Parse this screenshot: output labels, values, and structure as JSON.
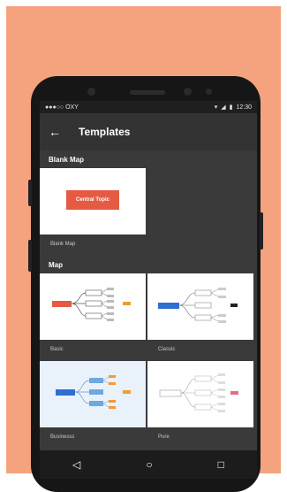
{
  "status": {
    "carrier": "●●●○○ OXY",
    "time": "12:30"
  },
  "header": {
    "title": "Templates"
  },
  "sections": {
    "blank": {
      "label": "Blank Map",
      "card_label": "Blank Map",
      "central_topic": "Central Topic"
    },
    "map": {
      "label": "Map",
      "cards": [
        {
          "label": "Basic"
        },
        {
          "label": "Classic"
        },
        {
          "label": "Businesss"
        },
        {
          "label": "Pure"
        }
      ]
    }
  },
  "colors": {
    "accent_red": "#e45a43",
    "accent_blue": "#2f6fcf",
    "accent_orange": "#f39a34",
    "accent_pink": "#e66b83",
    "background_orange": "#f5a27e"
  },
  "icons": {
    "back": "arrow-left-icon",
    "nav_back": "triangle-back-icon",
    "nav_home": "circle-home-icon",
    "nav_recent": "square-recent-icon"
  }
}
